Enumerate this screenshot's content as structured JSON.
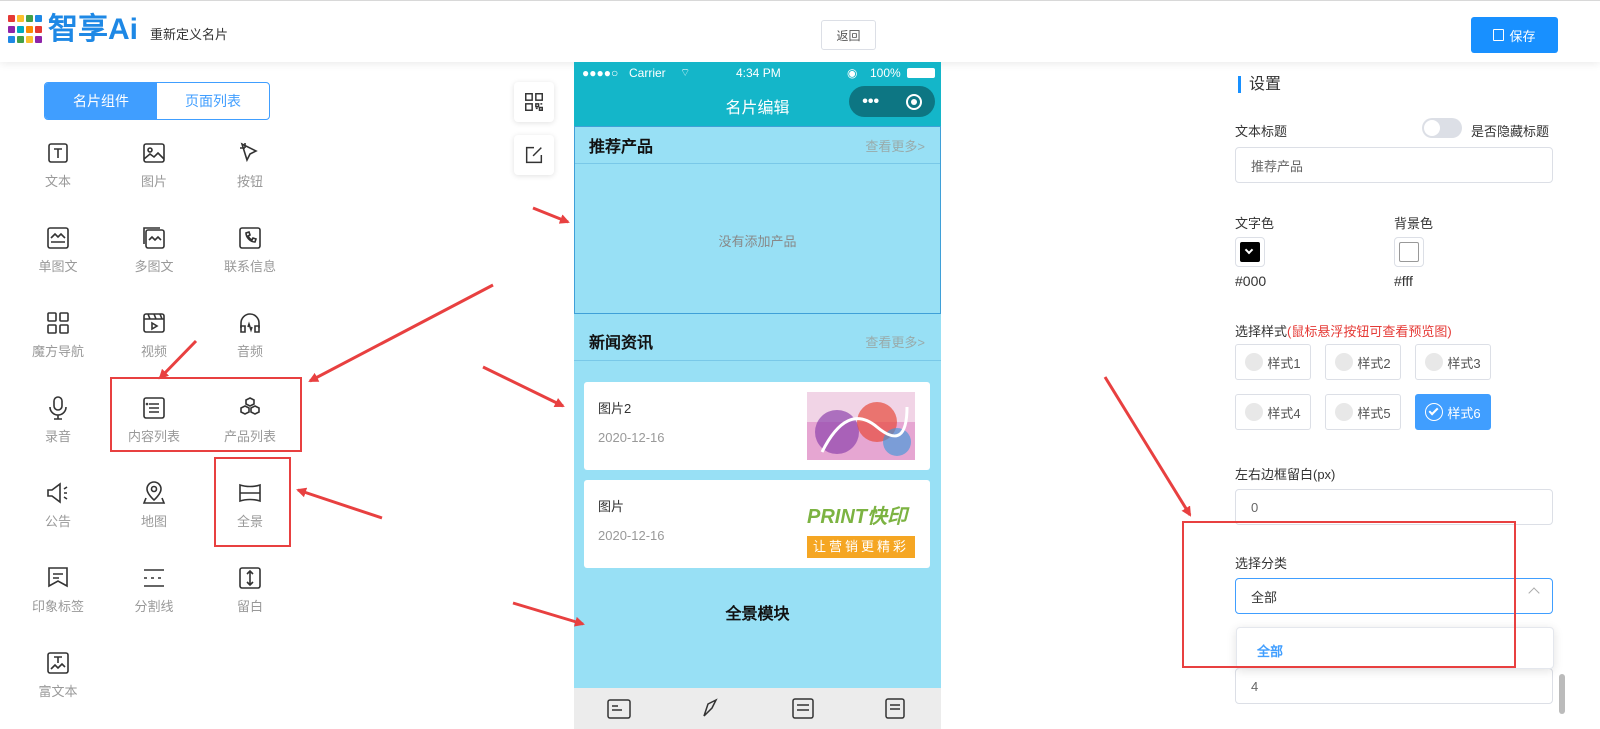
{
  "header": {
    "logo_text": "智享Ai",
    "subtitle": "重新定义名片",
    "back_label": "返回",
    "save_label": "保存"
  },
  "left_tabs": [
    "名片组件",
    "页面列表"
  ],
  "components": [
    {
      "label": "文本",
      "icon": "text-icon"
    },
    {
      "label": "图片",
      "icon": "image-icon"
    },
    {
      "label": "按钮",
      "icon": "button-pointer-icon"
    },
    {
      "label": "单图文",
      "icon": "single-article-icon"
    },
    {
      "label": "多图文",
      "icon": "multi-article-icon"
    },
    {
      "label": "联系信息",
      "icon": "contact-icon"
    },
    {
      "label": "魔方导航",
      "icon": "grid-nav-icon"
    },
    {
      "label": "视频",
      "icon": "video-icon"
    },
    {
      "label": "音频",
      "icon": "headphones-icon"
    },
    {
      "label": "录音",
      "icon": "microphone-icon"
    },
    {
      "label": "内容列表",
      "icon": "list-icon"
    },
    {
      "label": "产品列表",
      "icon": "cubes-icon"
    },
    {
      "label": "公告",
      "icon": "announcement-icon"
    },
    {
      "label": "地图",
      "icon": "map-pin-icon"
    },
    {
      "label": "全景",
      "icon": "panorama-icon"
    },
    {
      "label": "印象标签",
      "icon": "tag-icon"
    },
    {
      "label": "分割线",
      "icon": "divider-icon"
    },
    {
      "label": "留白",
      "icon": "whitespace-icon"
    },
    {
      "label": "富文本",
      "icon": "rich-text-icon"
    }
  ],
  "phone": {
    "status": {
      "signal": "●●●●○",
      "carrier": "Carrier",
      "time": "4:34 PM",
      "battery": "100%"
    },
    "nav_title": "名片编辑",
    "capsule_more": "•••",
    "products": {
      "title": "推荐产品",
      "more": "查看更多>",
      "empty": "没有添加产品"
    },
    "news": {
      "title": "新闻资讯",
      "more": "查看更多>",
      "items": [
        {
          "title": "图片2",
          "date": "2020-12-16"
        },
        {
          "title": "图片",
          "date": "2020-12-16",
          "img_text_top": "PRINT快印",
          "img_text_bottom": "让营销更精彩"
        }
      ]
    },
    "panorama_title": "全景模块"
  },
  "settings": {
    "title": "设置",
    "text_title_label": "文本标题",
    "hide_title_label": "是否隐藏标题",
    "text_title_value": "推荐产品",
    "text_color_label": "文字色",
    "bg_color_label": "背景色",
    "text_color_value": "#000",
    "bg_color_value": "#fff",
    "style_label": "选择样式",
    "style_hint": "(鼠标悬浮按钮可查看预览图)",
    "styles": [
      "样式1",
      "样式2",
      "样式3",
      "样式4",
      "样式5",
      "样式6"
    ],
    "selected_style": "样式6",
    "padding_label": "左右边框留白(px)",
    "padding_value": "0",
    "category_label": "选择分类",
    "category_value": "全部",
    "dropdown_option": "全部",
    "last_value": "4"
  },
  "colors": {
    "accent": "#1890ff",
    "phone_bar": "#14b6c9",
    "phone_bg": "#98e0f5",
    "annotation_red": "#e84040"
  }
}
